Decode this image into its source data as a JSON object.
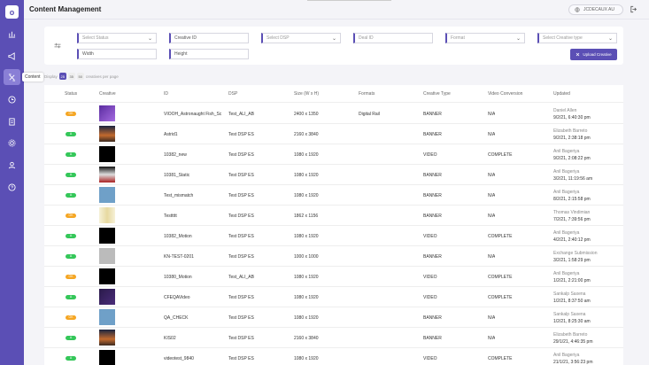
{
  "header": {
    "title": "Content Management",
    "user": "JCDECAUX AU"
  },
  "sidebar": {
    "tooltip": "Content",
    "logo": "o"
  },
  "filters": {
    "status": "Select Status",
    "creative_id": "Creative ID",
    "dsp": "Select DSP",
    "deal_id": "Deal ID",
    "format": "Format",
    "creative_type": "Select Creative type",
    "width": "Width",
    "height": "Height",
    "upload": "Upload Creative"
  },
  "pagination": {
    "display": "Display",
    "opts": [
      "25",
      "35",
      "50"
    ],
    "suffix": "creatives per page"
  },
  "columns": [
    "Status",
    "Creative",
    "ID",
    "DSP",
    "Size (W x H)",
    "Formats",
    "Creative Type",
    "Video Conversion",
    "Updated"
  ],
  "colors": {
    "accent": "#5b4fb5",
    "ok": "#34c759",
    "warn": "#f5a623"
  },
  "rows": [
    {
      "status": "OK",
      "id": "VIOOH_Astronaught Fish_Sc",
      "dsp": "Test_ALI_AB",
      "size": "2400 x 1350",
      "format": "Digital Rail",
      "type": "BANNER",
      "conv": "N/A",
      "user": "Daniel Allen",
      "date": "9/2/21, 6:40:30 pm"
    },
    {
      "status": "A",
      "id": "Astrid1",
      "dsp": "Test DSP ES",
      "size": "2160 x 3840",
      "format": "",
      "type": "BANNER",
      "conv": "N/A",
      "user": "Elizabeth Barreto",
      "date": "9/2/21, 2:38:18 pm"
    },
    {
      "status": "A",
      "id": "10382_new",
      "dsp": "Test DSP ES",
      "size": "1080 x 1920",
      "format": "",
      "type": "VIDEO",
      "conv": "COMPLETE",
      "user": "Anil Bageriya",
      "date": "9/2/21, 2:08:22 pm"
    },
    {
      "status": "A",
      "id": "10381_Static",
      "dsp": "Test DSP ES",
      "size": "1080 x 1920",
      "format": "",
      "type": "BANNER",
      "conv": "N/A",
      "user": "Anil Bageriya",
      "date": "3/2/21, 11:19:56 am"
    },
    {
      "status": "A",
      "id": "Test_mismatch",
      "dsp": "Test DSP ES",
      "size": "1080 x 1920",
      "format": "",
      "type": "BANNER",
      "conv": "N/A",
      "user": "Anil Bageriya",
      "date": "8/2/21, 2:15:58 pm"
    },
    {
      "status": "OK",
      "id": "Testtttt",
      "dsp": "Test DSP ES",
      "size": "1862 x 1156",
      "format": "",
      "type": "BANNER",
      "conv": "N/A",
      "user": "Thomas Vindimian",
      "date": "7/2/21, 7:39:56 pm"
    },
    {
      "status": "A",
      "id": "10382_Motion",
      "dsp": "Test DSP ES",
      "size": "1080 x 1920",
      "format": "",
      "type": "VIDEO",
      "conv": "COMPLETE",
      "user": "Anil Bageriya",
      "date": "4/2/21, 2:40:12 pm"
    },
    {
      "status": "A",
      "id": "KN-TEST-0201",
      "dsp": "Test DSP ES",
      "size": "1000 x 1000",
      "format": "",
      "type": "BANNER",
      "conv": "N/A",
      "user": "Exchange Submission",
      "date": "3/2/21, 1:58:29 pm"
    },
    {
      "status": "OK",
      "id": "10380_Motion",
      "dsp": "Test_ALI_AB",
      "size": "1080 x 1920",
      "format": "",
      "type": "VIDEO",
      "conv": "COMPLETE",
      "user": "Anil Bageriya",
      "date": "1/2/21, 2:21:00 pm"
    },
    {
      "status": "A",
      "id": "CFEQAVideo",
      "dsp": "Test DSP ES",
      "size": "1080 x 1920",
      "format": "",
      "type": "VIDEO",
      "conv": "COMPLETE",
      "user": "Sankalp Saxena",
      "date": "1/2/21, 8:37:50 am"
    },
    {
      "status": "OK",
      "id": "QA_CHECK",
      "dsp": "Test DSP ES",
      "size": "1080 x 1920",
      "format": "",
      "type": "BANNER",
      "conv": "N/A",
      "user": "Sankalp Saxena",
      "date": "1/2/21, 8:25:30 am"
    },
    {
      "status": "A",
      "id": "KIS02",
      "dsp": "Test DSP ES",
      "size": "2160 x 3840",
      "format": "",
      "type": "BANNER",
      "conv": "N/A",
      "user": "Elizabeth Barreto",
      "date": "29/1/21, 4:46:35 pm"
    },
    {
      "status": "A",
      "id": "videotest_9840",
      "dsp": "Test DSP ES",
      "size": "1080 x 1920",
      "format": "",
      "type": "VIDEO",
      "conv": "COMPLETE",
      "user": "Anil Bageriya",
      "date": "21/1/21, 3:56:23 pm"
    }
  ]
}
